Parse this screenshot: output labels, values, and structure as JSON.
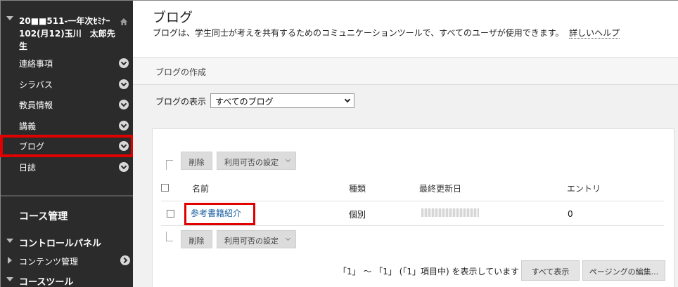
{
  "sidebar": {
    "course_title": "20■■511-一年次ｾﾐﾅｰ102(月12)玉川　太郎先生",
    "items": [
      {
        "label": "連絡事項"
      },
      {
        "label": "シラバス"
      },
      {
        "label": "教員情報"
      },
      {
        "label": "講義"
      },
      {
        "label": "ブログ"
      },
      {
        "label": "日誌"
      }
    ],
    "course_management": "コース管理",
    "control_panel": "コントロールパネル",
    "content_management": "コンテンツ管理",
    "course_tools": "コースツール"
  },
  "header": {
    "title": "ブログ",
    "description": "ブログは、学生同士が考えを共有するためのコミュニケーションツールで、すべてのユーザが使用できます。",
    "help_link": "詳しいヘルプ"
  },
  "toolbar": {
    "create_blog": "ブログの作成"
  },
  "filter": {
    "label": "ブログの表示",
    "selected": "すべてのブログ"
  },
  "actions": {
    "delete": "削除",
    "availability": "利用可否の設定"
  },
  "table": {
    "columns": [
      "名前",
      "種類",
      "最終更新日",
      "エントリ"
    ],
    "rows": [
      {
        "name": "参考書籍紹介",
        "type": "個別",
        "last_updated": "",
        "entries": "0"
      }
    ]
  },
  "paging": {
    "status": "「1」 ～ 「1」 (「1」項目中) を表示しています",
    "show_all": "すべて表示",
    "edit_paging": "ページングの編集..."
  },
  "colors": {
    "sidebar_bg": "#2b2b2b",
    "highlight": "#e00000",
    "link": "#1a5fa0"
  }
}
